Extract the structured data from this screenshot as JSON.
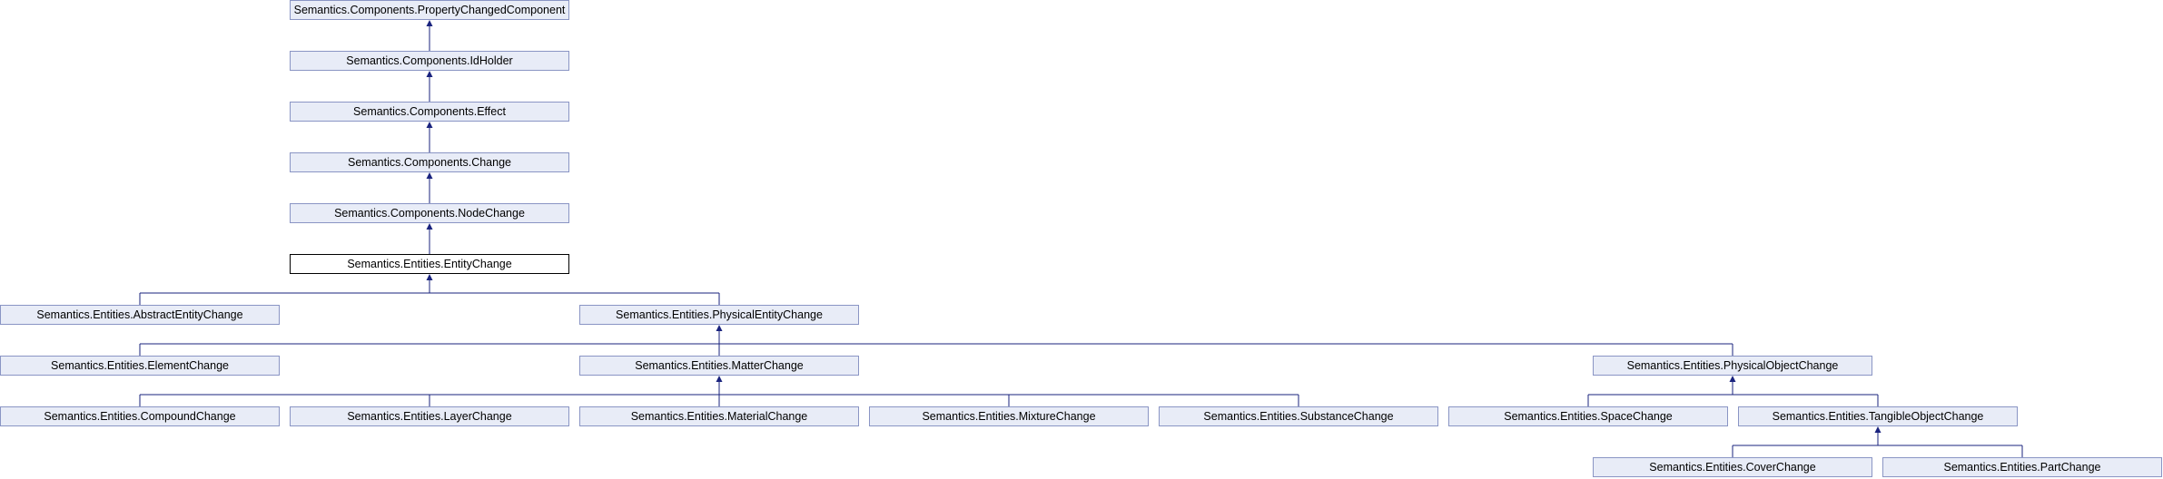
{
  "diagram": {
    "colors": {
      "edge": "#1a237e",
      "node_fill": "#e8ecf7",
      "node_border": "#8a95c4",
      "current_border": "#000000"
    },
    "nodes": {
      "property_changed_component": "Semantics.Components.PropertyChangedComponent",
      "id_holder": "Semantics.Components.IdHolder",
      "effect": "Semantics.Components.Effect",
      "change": "Semantics.Components.Change",
      "node_change": "Semantics.Components.NodeChange",
      "entity_change": "Semantics.Entities.EntityChange",
      "abstract_entity_change": "Semantics.Entities.AbstractEntityChange",
      "physical_entity_change": "Semantics.Entities.PhysicalEntityChange",
      "element_change": "Semantics.Entities.ElementChange",
      "matter_change": "Semantics.Entities.MatterChange",
      "physical_object_change": "Semantics.Entities.PhysicalObjectChange",
      "compound_change": "Semantics.Entities.CompoundChange",
      "layer_change": "Semantics.Entities.LayerChange",
      "material_change": "Semantics.Entities.MaterialChange",
      "mixture_change": "Semantics.Entities.MixtureChange",
      "substance_change": "Semantics.Entities.SubstanceChange",
      "space_change": "Semantics.Entities.SpaceChange",
      "tangible_object_change": "Semantics.Entities.TangibleObjectChange",
      "cover_change": "Semantics.Entities.CoverChange",
      "part_change": "Semantics.Entities.PartChange"
    },
    "edges": [
      {
        "parent": "property_changed_component",
        "children": [
          "id_holder"
        ]
      },
      {
        "parent": "id_holder",
        "children": [
          "effect"
        ]
      },
      {
        "parent": "effect",
        "children": [
          "change"
        ]
      },
      {
        "parent": "change",
        "children": [
          "node_change"
        ]
      },
      {
        "parent": "node_change",
        "children": [
          "entity_change"
        ]
      },
      {
        "parent": "entity_change",
        "children": [
          "abstract_entity_change",
          "physical_entity_change"
        ]
      },
      {
        "parent": "physical_entity_change",
        "children": [
          "element_change",
          "matter_change",
          "physical_object_change"
        ]
      },
      {
        "parent": "matter_change",
        "children": [
          "compound_change",
          "layer_change",
          "material_change",
          "mixture_change",
          "substance_change"
        ]
      },
      {
        "parent": "physical_object_change",
        "children": [
          "space_change",
          "tangible_object_change"
        ]
      },
      {
        "parent": "tangible_object_change",
        "children": [
          "cover_change",
          "part_change"
        ]
      }
    ]
  }
}
